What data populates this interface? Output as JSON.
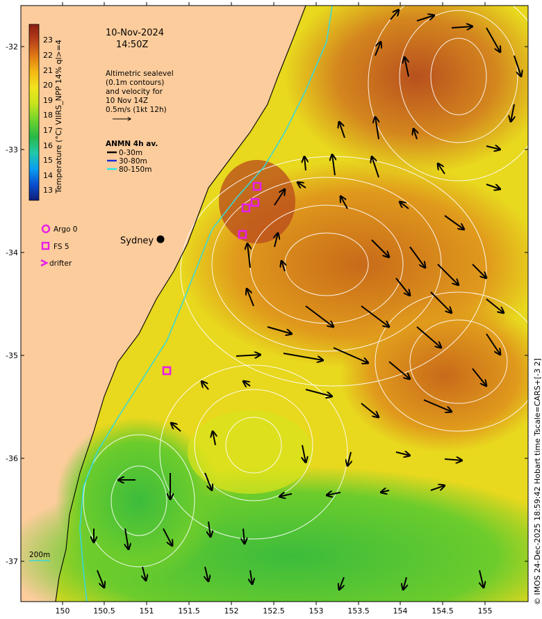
{
  "title": {
    "date": "10-Nov-2024",
    "time": "14:50Z"
  },
  "note": {
    "lines": [
      "Altimetric sealevel",
      "(0.1m contours)",
      "and velocity for",
      "10 Nov 14Z",
      "0.5m/s (1kt 12h)"
    ]
  },
  "mooring_legend": {
    "title": "ANMN 4h av.",
    "items": [
      {
        "label": "0-30m",
        "color": "#000000"
      },
      {
        "label": "30-80m",
        "color": "#1f2bd6"
      },
      {
        "label": "80-150m",
        "color": "#2ee6e6"
      }
    ]
  },
  "colorbar": {
    "label": "Temperature (°C) VIIRS_NPP 14% ql>=4",
    "ticks": [
      13,
      14,
      15,
      16,
      17,
      18,
      19,
      20,
      21,
      22,
      23
    ],
    "stops": [
      "#101c7a",
      "#0a4fd0",
      "#0a9ff0",
      "#22c8a8",
      "#28b848",
      "#6ad22e",
      "#c8e41e",
      "#f2e41c",
      "#f4b814",
      "#e07a14",
      "#b8401a",
      "#8a1c12"
    ]
  },
  "platform_legend": [
    {
      "label": "Argo 0",
      "symbol": "circle",
      "color": "#e81ee8"
    },
    {
      "label": "FS 5",
      "symbol": "square",
      "color": "#e81ee8"
    },
    {
      "label": "drifter",
      "symbol": "chevron",
      "color": "#e81ee8"
    }
  ],
  "city": {
    "label": "Sydney"
  },
  "isobath": {
    "label": "200m",
    "color": "#3ad8d8"
  },
  "axes": {
    "x_ticks": [
      "150",
      "150.5",
      "151",
      "151.5",
      "152",
      "152.5",
      "153",
      "153.5",
      "154",
      "154.5",
      "155"
    ],
    "y_ticks": [
      "-32",
      "-33",
      "-34",
      "-35",
      "-36",
      "-37"
    ],
    "lon_range": [
      149.5,
      155.5
    ],
    "lat_range": [
      -37.42,
      -31.7
    ]
  },
  "credit": "© IMOS 24-Dec-2025 18:59:42 Hobart time Tscale=CARS+[-3 2]",
  "colors": {
    "land": "#fccc9c",
    "contour": "#ffffff",
    "arrow": "#000000",
    "marker": "#e81ee8"
  }
}
